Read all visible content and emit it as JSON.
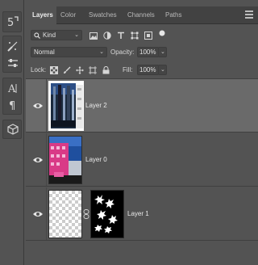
{
  "tabs": [
    {
      "label": "Layers",
      "active": true
    },
    {
      "label": "Color",
      "active": false
    },
    {
      "label": "Swatches",
      "active": false
    },
    {
      "label": "Channels",
      "active": false
    },
    {
      "label": "Paths",
      "active": false
    }
  ],
  "filter": {
    "kind_label": "Kind",
    "icons": [
      "image-filter-icon",
      "adjustment-filter-icon",
      "type-filter-icon",
      "shape-filter-icon",
      "smart-object-filter-icon",
      "filter-toggle-icon"
    ]
  },
  "blend": {
    "mode": "Normal",
    "opacity_label": "Opacity:",
    "opacity_value": "100%"
  },
  "lock": {
    "label": "Lock:",
    "icons": [
      "lock-transparent-icon",
      "lock-paint-icon",
      "lock-position-icon",
      "lock-artboard-icon",
      "lock-all-icon"
    ],
    "fill_label": "Fill:",
    "fill_value": "100%"
  },
  "layers": [
    {
      "name": "Layer 2",
      "selected": true,
      "visible": true
    },
    {
      "name": "Layer 0",
      "selected": false,
      "visible": true
    },
    {
      "name": "Layer 1",
      "selected": false,
      "visible": true,
      "has_mask": true
    }
  ],
  "colors": {
    "panel_bg": "#535353",
    "selected_row": "#6a6a6a",
    "tab_bar": "#424242"
  }
}
